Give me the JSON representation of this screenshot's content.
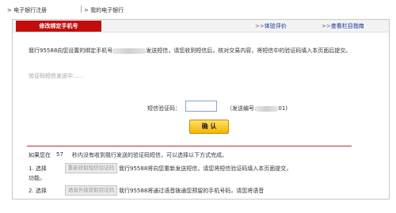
{
  "breadcrumb": {
    "items": [
      {
        "label": "电子银行注册"
      },
      {
        "label": "我的电子银行"
      }
    ]
  },
  "panel": {
    "title": "修改绑定手机号",
    "links": [
      {
        "chevron": ">>",
        "label": "体验评价"
      },
      {
        "chevron": ">>",
        "label": "查看栏目指南"
      }
    ]
  },
  "message": {
    "part1": "我行95588向您设置的绑定手机号",
    "part2": "发送短信，请您收到短信后，核对交易内容，将短信中的验证码填入本页面后提交。"
  },
  "sending_text": "验证码短信发送中......",
  "form": {
    "label": "短信验证码：",
    "input_value": "",
    "serial_prefix": "（发送编号:",
    "serial_suffix": "01)"
  },
  "confirm_label": "确 认",
  "fallback": {
    "prefix": "如果您在",
    "seconds": "57",
    "suffix": "秒内没有收到我行发送的验证码短信，可以选择以下方式完成。",
    "options": [
      {
        "number": "1. 选择",
        "button_label": "重新获取短信验证码",
        "text": "我行95588将向您重新发送短信，请您将短信验证码填入本页面提交，",
        "continuation": "功能。"
      },
      {
        "number": "2. 选择",
        "button_label": "语音外拨获取验证码",
        "text": "我行95588将通过语音拨通您预留的手机号码，请您将语音"
      }
    ]
  }
}
